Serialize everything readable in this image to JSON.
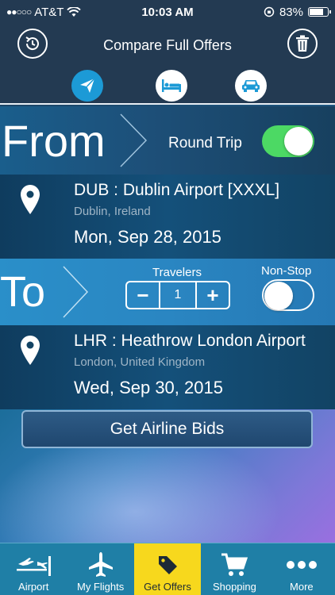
{
  "status": {
    "carrier": "AT&T",
    "time": "10:03 AM",
    "battery": "83%",
    "battery_level": 0.83
  },
  "header": {
    "title": "Compare Full Offers",
    "history_icon": "clock-history-icon",
    "delete_icon": "trash-icon",
    "categories": [
      "flights",
      "hotels",
      "cars"
    ],
    "active_category": "flights"
  },
  "from": {
    "label": "From",
    "round_trip_label": "Round Trip",
    "round_trip_on": true,
    "airport": "DUB : Dublin Airport [XXXL]",
    "city": "Dublin, Ireland",
    "date": "Mon, Sep 28, 2015"
  },
  "to": {
    "label": "To",
    "travelers_label": "Travelers",
    "travelers": "1",
    "minus": "−",
    "plus": "+",
    "nonstop_label": "Non-Stop",
    "nonstop_on": false,
    "airport": "LHR : Heathrow London Airport",
    "city": "London, United Kingdom",
    "date": "Wed, Sep 30, 2015"
  },
  "action": {
    "bids_label": "Get Airline Bids"
  },
  "tabs": [
    {
      "label": "Airport",
      "icon": "airport-icon"
    },
    {
      "label": "My Flights",
      "icon": "airplane-icon"
    },
    {
      "label": "Get Offers",
      "icon": "tag-icon",
      "active": true
    },
    {
      "label": "Shopping",
      "icon": "cart-icon"
    },
    {
      "label": "More",
      "icon": "more-dots-icon"
    }
  ],
  "colors": {
    "accent": "#1c9ad6",
    "toggle_on": "#4cd964",
    "tab_active": "#f7d81d",
    "tab_bar": "#1f7fa6"
  }
}
